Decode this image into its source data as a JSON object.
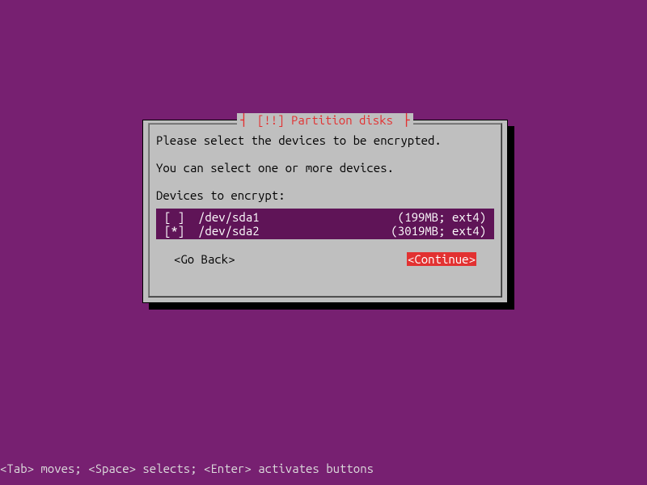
{
  "dialog": {
    "title_pipe_left": "┤",
    "title_text": " [!!] Partition disks ",
    "title_pipe_right": "├",
    "instruction": "Please select the devices to be encrypted.",
    "subinstruction": "You can select one or more devices.",
    "label": "Devices to encrypt:",
    "devices": [
      {
        "checkbox": "[ ]",
        "path": "/dev/sda1",
        "info": "(199MB; ext4)"
      },
      {
        "checkbox": "[*]",
        "path": "/dev/sda2",
        "info": "(3019MB; ext4)"
      }
    ],
    "go_back_label": "<Go Back>",
    "continue_label": "<Continue>"
  },
  "footer": {
    "hint": "<Tab> moves; <Space> selects; <Enter> activates buttons"
  }
}
